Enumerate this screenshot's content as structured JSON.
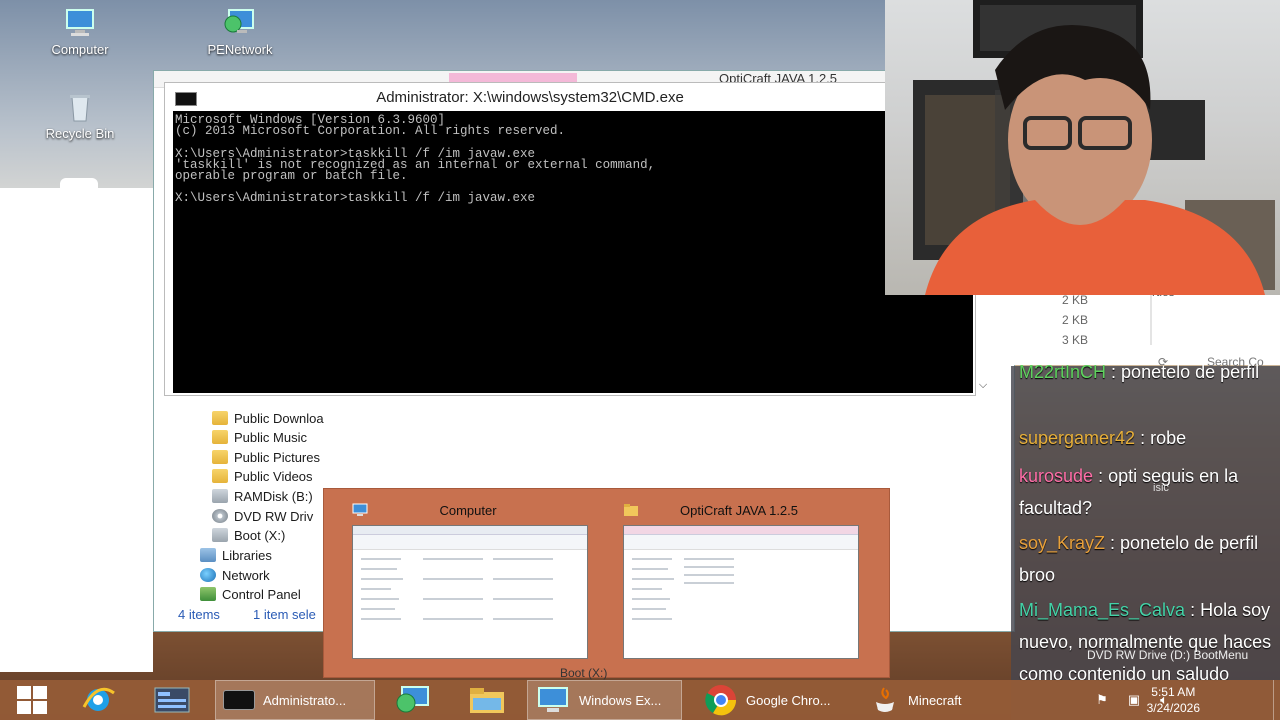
{
  "desktop": {
    "icons": [
      {
        "label": "Computer"
      },
      {
        "label": "PENetwork"
      },
      {
        "label": "Recycle Bin"
      }
    ]
  },
  "cmd": {
    "title": "Administrator: X:\\windows\\system32\\CMD.exe",
    "lines": [
      "Microsoft Windows [Version 6.3.9600]",
      "(c) 2013 Microsoft Corporation. All rights reserved.",
      "",
      "X:\\Users\\Administrator>taskkill /f /im javaw.exe",
      "'taskkill' is not recognized as an internal or external command,",
      "operable program or batch file.",
      "",
      "X:\\Users\\Administrator>taskkill /f /im javaw.exe"
    ]
  },
  "explorer": {
    "ghost_title": "OptiCraft JAVA 1.2.5",
    "nav": [
      {
        "label": "Public Downloa",
        "icon": "folder-icon"
      },
      {
        "label": "Public Music",
        "icon": "folder-icon"
      },
      {
        "label": "Public Pictures",
        "icon": "folder-icon"
      },
      {
        "label": "Public Videos",
        "icon": "folder-icon"
      },
      {
        "label": "RAMDisk (B:)",
        "icon": "drive-icon"
      },
      {
        "label": "DVD RW Driv",
        "icon": "disc-icon"
      },
      {
        "label": "Boot (X:)",
        "icon": "drive-icon"
      },
      {
        "label": "Libraries",
        "icon": "library-icon"
      },
      {
        "label": "Network",
        "icon": "network-icon"
      },
      {
        "label": "Control Panel",
        "icon": "control-panel-icon"
      }
    ],
    "status_items": "4 items",
    "status_selected": "1 item sele",
    "sizes": [
      "2 KB",
      "2 KB",
      "3 KB"
    ],
    "search_placeholder": "Search Co",
    "ghost_texts": [
      "rties",
      "isic",
      "DVD RW Drive (D:) BootMenu",
      "Boot (X:)"
    ]
  },
  "chat": {
    "messages": [
      {
        "user": "M22rtInCH",
        "color": "#5fd35f",
        "text": "ponetelo de perfil"
      },
      {
        "user": "supergamer42",
        "color": "#e8b03a",
        "text": "robe"
      },
      {
        "user": "kurosude",
        "color": "#ff6ea8",
        "text": "opti seguis en la facultad?"
      },
      {
        "user": "soy_KrayZ",
        "color": "#e8a03a",
        "text": "ponetelo de perfil broo"
      },
      {
        "user": "Mi_Mama_Es_Calva",
        "color": "#44d3a8",
        "text": "Hola soy nuevo, normalmente que haces como contenido un saludo"
      }
    ]
  },
  "preview": {
    "items": [
      {
        "title": "Computer"
      },
      {
        "title": "OptiCraft JAVA 1.2.5"
      }
    ]
  },
  "taskbar": {
    "buttons": [
      {
        "label": "Administrato..."
      },
      {
        "label": "Windows Ex..."
      },
      {
        "label": "Google Chro..."
      },
      {
        "label": "Minecraft"
      }
    ],
    "time": "5:51 AM",
    "date": "3/24/2026"
  }
}
